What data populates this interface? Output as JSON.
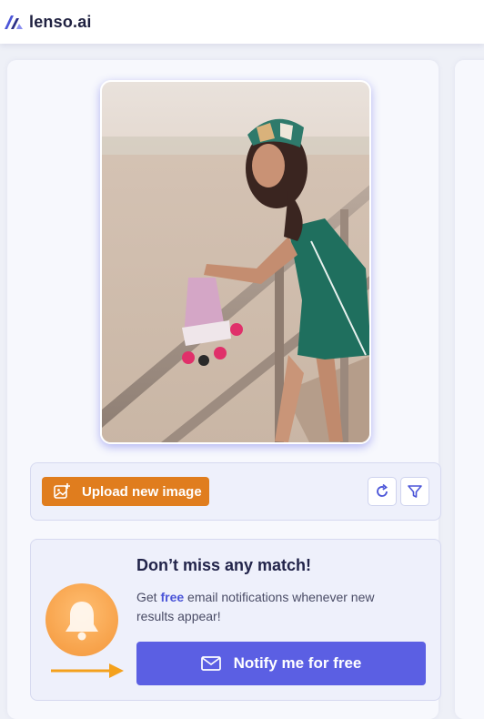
{
  "header": {
    "logo_text": "lenso.ai",
    "brand_color": "#4b55d8"
  },
  "search_image": {
    "description_icon": "uploaded-photo"
  },
  "upload_bar": {
    "upload_label": "Upload new image",
    "upload_icon": "image-plus-icon",
    "refresh_icon": "refresh-icon",
    "filter_icon": "filter-icon",
    "upload_color": "#e07d1e"
  },
  "notify": {
    "title": "Don’t miss any match!",
    "desc_before": "Get ",
    "desc_highlight": "free",
    "desc_after": " email notifications whenever new results appear!",
    "button_label": "Notify me for free",
    "button_icon": "mail-icon",
    "bell_icon": "bell-icon",
    "button_color": "#5b5fe3"
  }
}
